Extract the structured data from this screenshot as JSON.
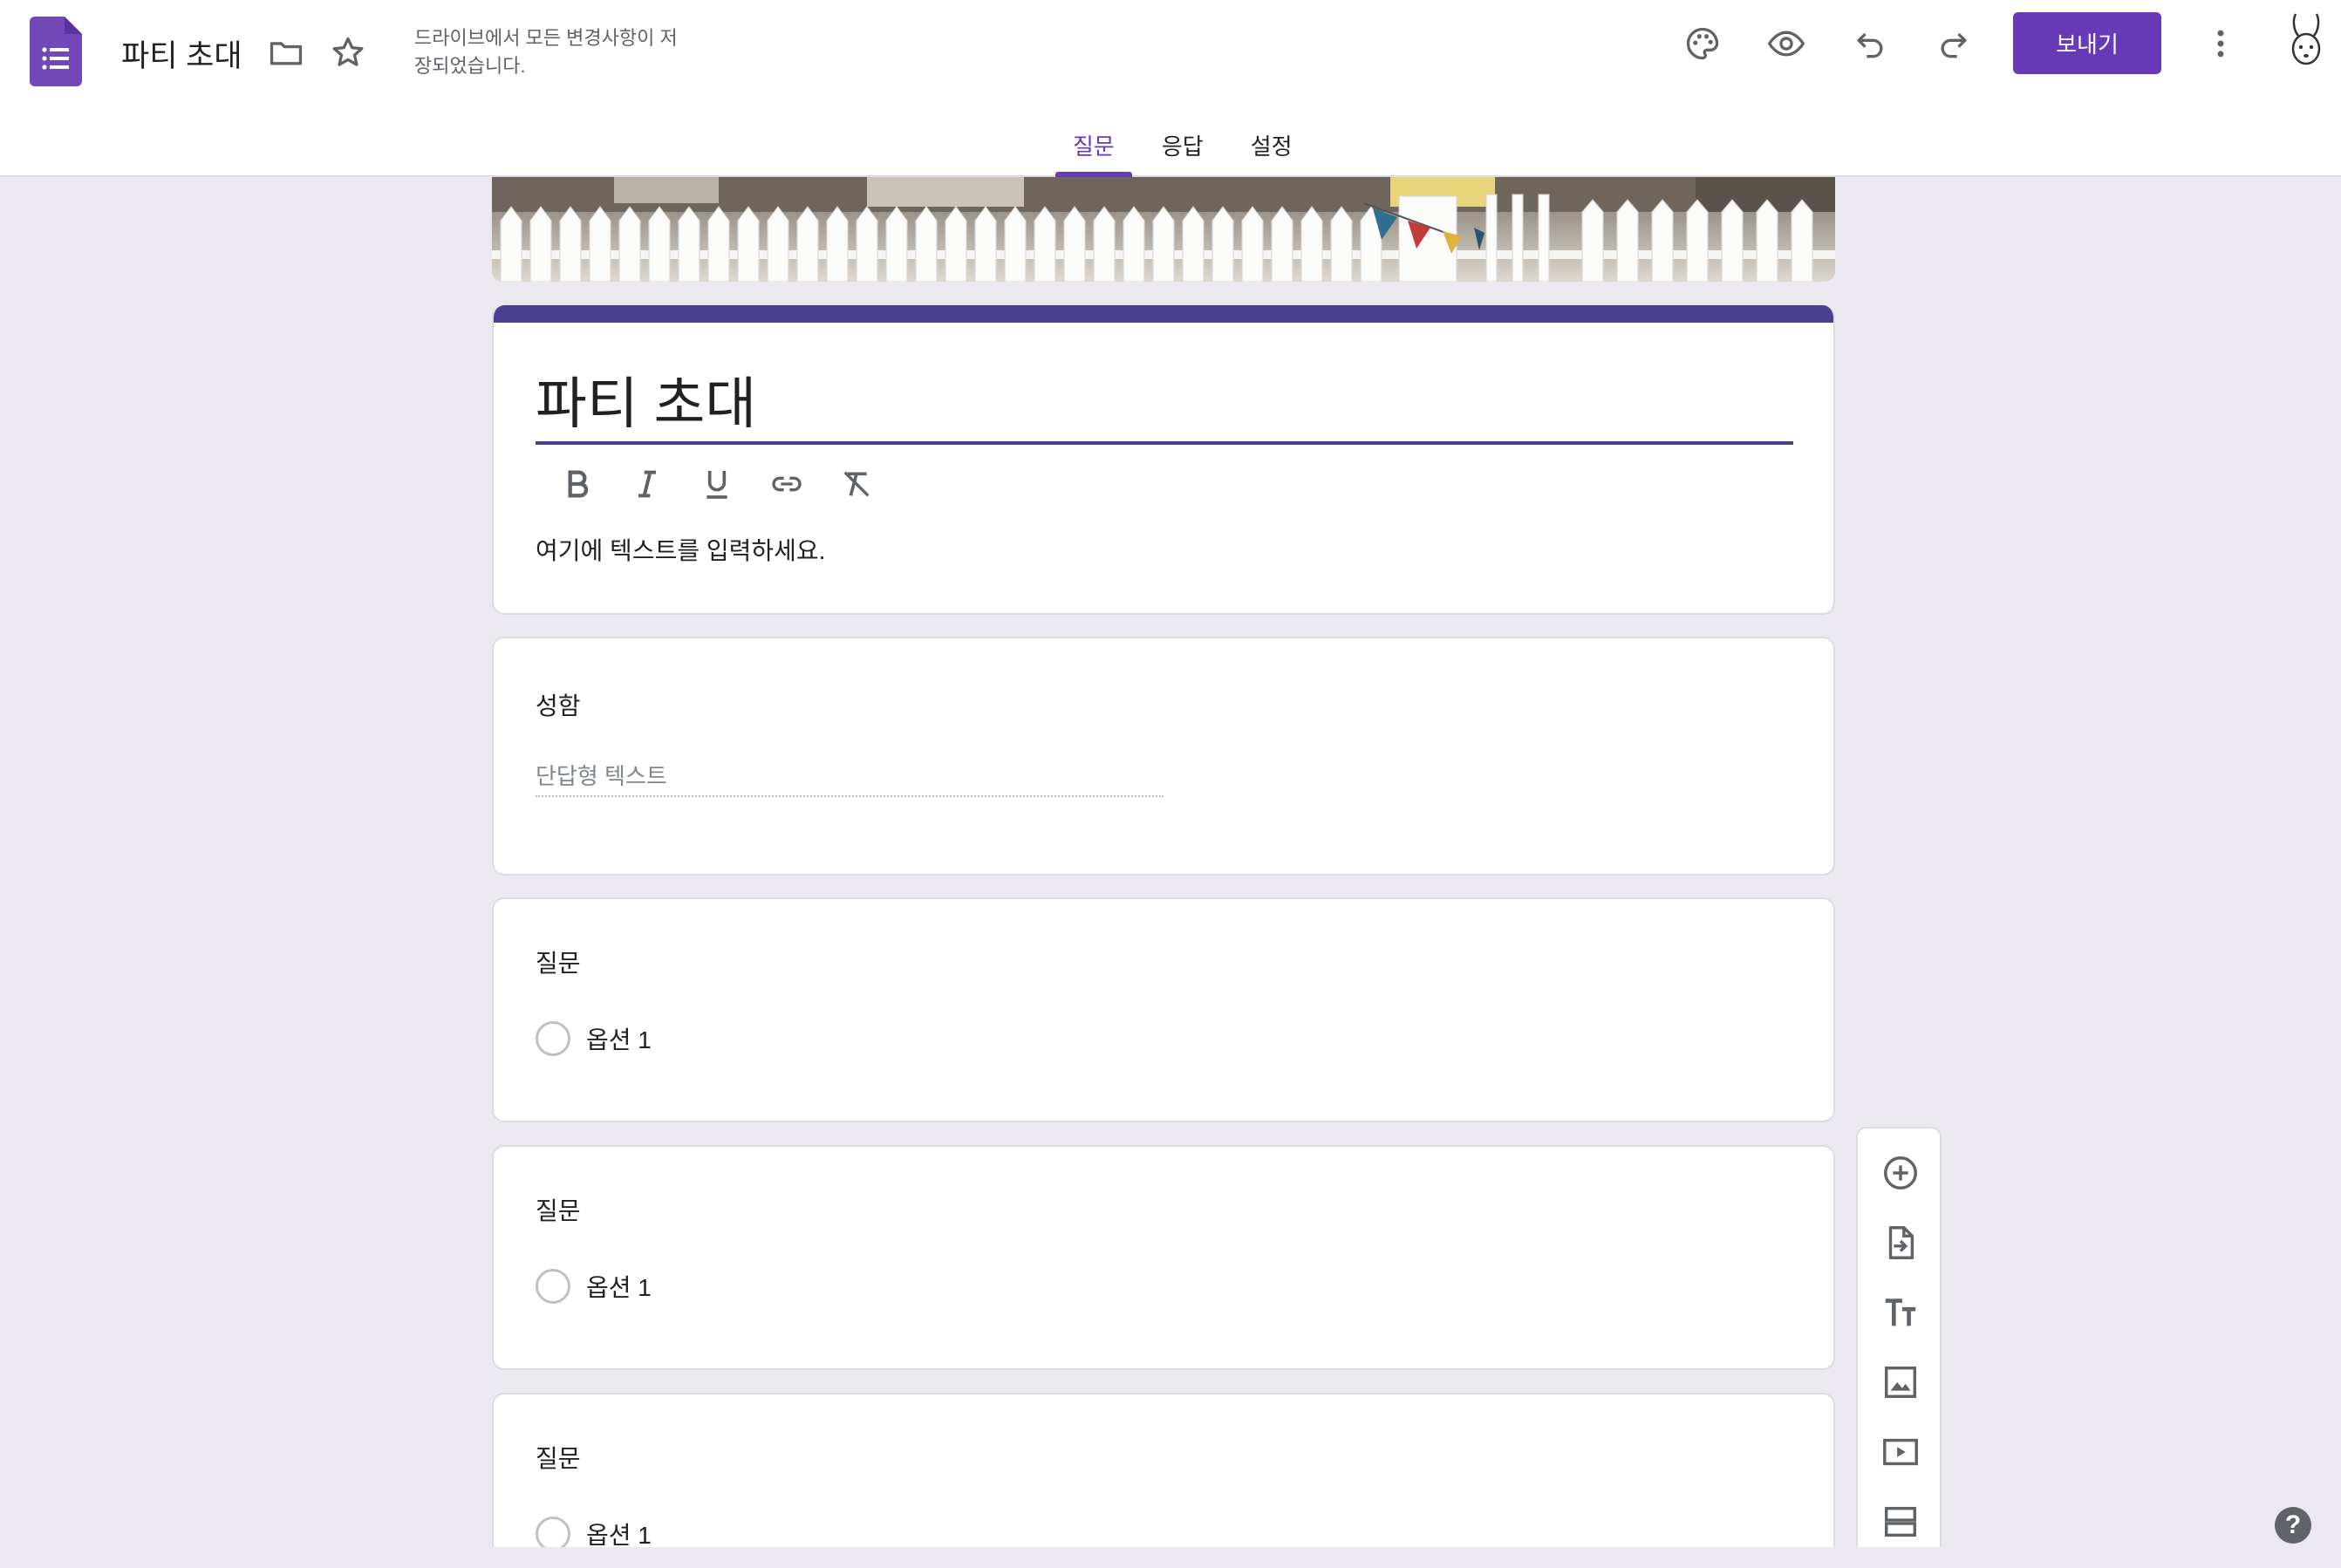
{
  "header": {
    "doc_title": "파티 초대",
    "save_status_line1": "드라이브에서 모든 변경사항이 저",
    "save_status_line2": "장되었습니다.",
    "send_label": "보내기",
    "icons": [
      "forms-logo-icon",
      "folder-icon",
      "star-icon",
      "palette-icon",
      "preview-eye-icon",
      "undo-icon",
      "redo-icon",
      "more-vert-icon"
    ]
  },
  "tabs": [
    {
      "label": "질문",
      "active": true
    },
    {
      "label": "응답",
      "active": false
    },
    {
      "label": "설정",
      "active": false
    }
  ],
  "form": {
    "title": "파티 초대",
    "description_placeholder": "여기에 텍스트를 입력하세요.",
    "format_tools": [
      "bold-icon",
      "italic-icon",
      "underline-icon",
      "link-icon",
      "clear-format-icon"
    ]
  },
  "questions": [
    {
      "title": "성함",
      "type": "short",
      "answer_placeholder": "단답형 텍스트"
    },
    {
      "title": "질문",
      "type": "radio",
      "option": "옵션 1"
    },
    {
      "title": "질문",
      "type": "radio",
      "option": "옵션 1"
    },
    {
      "title": "질문",
      "type": "radio",
      "option": "옵션 1"
    }
  ],
  "side_toolbar": [
    "add-question-icon",
    "import-questions-icon",
    "add-title-icon",
    "add-image-icon",
    "add-video-icon",
    "add-section-icon"
  ],
  "colors": {
    "accent": "#673ab7",
    "title_bar": "#4a3e8e",
    "background": "#ebe9ef"
  },
  "help": "?"
}
